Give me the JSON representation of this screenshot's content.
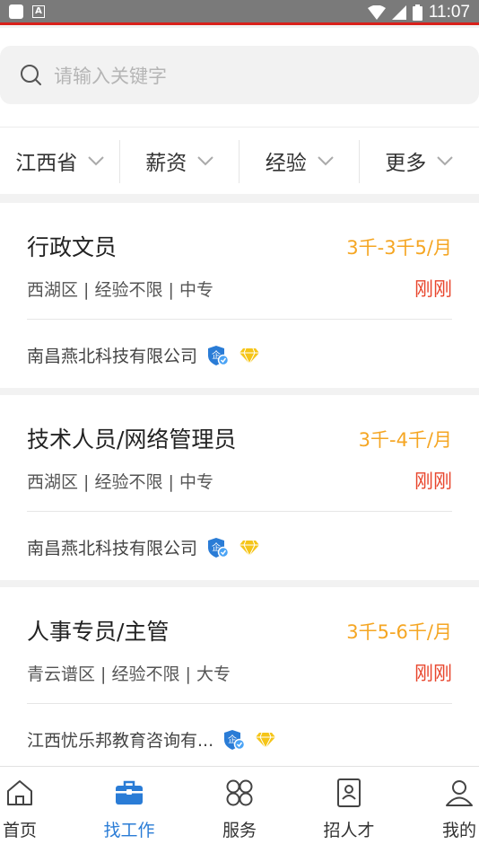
{
  "status_bar": {
    "time": "11:07"
  },
  "search": {
    "placeholder": "请输入关键字"
  },
  "filters": [
    {
      "label": "江西省"
    },
    {
      "label": "薪资"
    },
    {
      "label": "经验"
    },
    {
      "label": "更多"
    }
  ],
  "jobs": [
    {
      "title": "行政文员",
      "salary": "3千-3千5/月",
      "meta": "西湖区 | 经验不限 | 中专",
      "time": "刚刚",
      "company": "南昌燕北科技有限公司"
    },
    {
      "title": "技术人员/网络管理员",
      "salary": "3千-4千/月",
      "meta": "西湖区 | 经验不限 | 中专",
      "time": "刚刚",
      "company": "南昌燕北科技有限公司"
    },
    {
      "title": "人事专员/主管",
      "salary": "3千5-6千/月",
      "meta": "青云谱区 | 经验不限 | 大专",
      "time": "刚刚",
      "company": "江西忧乐邦教育咨询有..."
    }
  ],
  "tabbar": [
    {
      "label": "首页",
      "icon": "home-icon"
    },
    {
      "label": "找工作",
      "icon": "briefcase-icon",
      "active": true
    },
    {
      "label": "服务",
      "icon": "services-icon"
    },
    {
      "label": "招人才",
      "icon": "resume-icon"
    },
    {
      "label": "我的",
      "icon": "profile-icon"
    }
  ],
  "colors": {
    "accent": "#2a7cd6",
    "salary": "#f5a623",
    "time": "#e8452c",
    "status_line": "#d9201a"
  }
}
